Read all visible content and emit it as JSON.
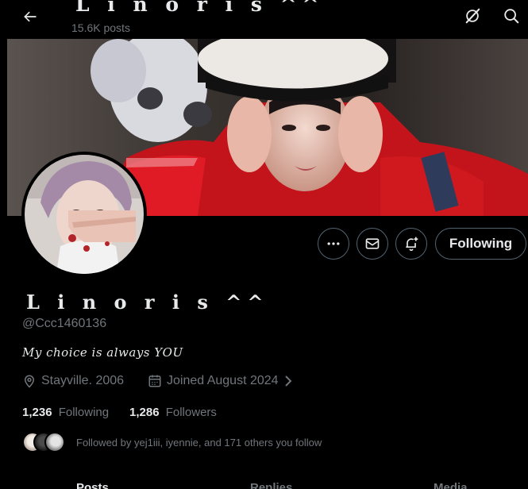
{
  "header": {
    "title": "L i n o r i s ^^",
    "posts_count": "15.6K posts"
  },
  "profile": {
    "name": "L i n o r i s ^^",
    "handle": "@Ccc1460136",
    "bio": "My choice is always YOU",
    "location": "Stayville. 2006",
    "joined": "Joined August 2024",
    "following_count": "1,236",
    "following_label": "Following",
    "followers_count": "1,286",
    "followers_label": "Followers",
    "followed_by": "Followed by yej1iii, iyennie, and 171 others you follow"
  },
  "actions": {
    "follow_label": "Following"
  },
  "tabs": [
    {
      "label": "Posts"
    },
    {
      "label": "Replies"
    },
    {
      "label": "Media"
    }
  ],
  "icons": [
    "back-arrow-icon",
    "grok-icon",
    "search-icon",
    "more-icon",
    "mail-icon",
    "bell-plus-icon",
    "location-pin-icon",
    "calendar-icon",
    "chevron-right-icon"
  ],
  "colors": {
    "background": "#000000",
    "text_primary": "#e7e9ea",
    "text_secondary": "#71767b",
    "border": "#536471"
  }
}
